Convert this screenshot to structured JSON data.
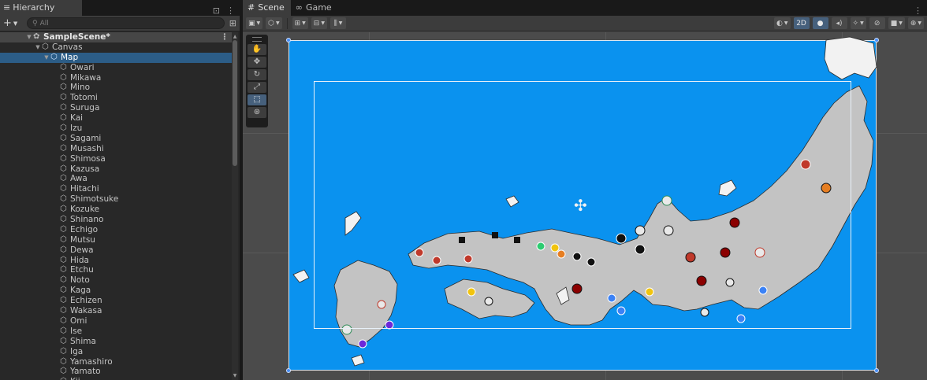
{
  "hierarchy": {
    "tab_label": "Hierarchy",
    "search_placeholder": "All",
    "scene_name": "SampleScene*",
    "canvas": "Canvas",
    "map": "Map",
    "provinces": [
      "Owari",
      "Mikawa",
      "Mino",
      "Totomi",
      "Suruga",
      "Kai",
      "Izu",
      "Sagami",
      "Musashi",
      "Shimosa",
      "Kazusa",
      "Awa",
      "Hitachi",
      "Shimotsuke",
      "Kozuke",
      "Shinano",
      "Echigo",
      "Mutsu",
      "Dewa",
      "Hida",
      "Etchu",
      "Noto",
      "Kaga",
      "Echizen",
      "Wakasa",
      "Omi",
      "Ise",
      "Shima",
      "Iga",
      "Yamashiro",
      "Yamato",
      "Kii"
    ]
  },
  "scene": {
    "tab_scene": "Scene",
    "tab_game": "Game",
    "btn_2d": "2D"
  },
  "colors": {
    "ocean": "#0a92ef",
    "land": "#c3c3c3",
    "selection": "#2c5d87",
    "accent_button": "#46607c"
  },
  "icons": [
    "hamburger-icon",
    "lock-icon",
    "kebab-icon",
    "plus-icon",
    "search-icon",
    "scene-icon",
    "gameobject-cube-icon",
    "grid-icon",
    "gamepad-icon",
    "hand-icon",
    "move-icon",
    "rotate-icon",
    "scale-icon",
    "rect-tool-icon",
    "transform-icon",
    "light-icon",
    "audio-icon",
    "effects-icon",
    "visibility-icon",
    "camera-icon",
    "gizmos-icon"
  ]
}
